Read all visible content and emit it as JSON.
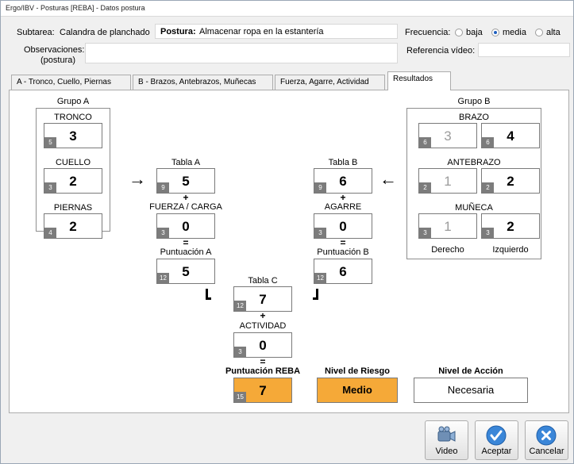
{
  "window": {
    "title": "Ergo/IBV - Posturas [REBA] - Datos postura"
  },
  "header": {
    "subtarea_label": "Subtarea:",
    "subtarea_value": "Calandra de planchado",
    "postura_label": "Postura:",
    "postura_value": "Almacenar ropa en la estantería",
    "frecuencia_label": "Frecuencia:",
    "frecuencia_options": [
      "baja",
      "media",
      "alta"
    ],
    "frecuencia_selected": "media",
    "observaciones_label_1": "Observaciones:",
    "observaciones_label_2": "(postura)",
    "observaciones_value": "",
    "referencia_label": "Referencia vídeo:",
    "referencia_value": ""
  },
  "tabs": [
    {
      "label": "A - Tronco, Cuello, Piernas"
    },
    {
      "label": "B - Brazos, Antebrazos, Muñecas"
    },
    {
      "label": "Fuerza, Agarre, Actividad"
    },
    {
      "label": "Resultados"
    }
  ],
  "active_tab": "Resultados",
  "grupo_a": {
    "title": "Grupo A",
    "tronco": {
      "label": "TRONCO",
      "value": "3",
      "badge": "5"
    },
    "cuello": {
      "label": "CUELLO",
      "value": "2",
      "badge": "3"
    },
    "piernas": {
      "label": "PIERNAS",
      "value": "2",
      "badge": "4"
    }
  },
  "grupo_b": {
    "title": "Grupo B",
    "brazo": {
      "label": "BRAZO",
      "derecho": "3",
      "derecho_badge": "6",
      "izquierdo": "4",
      "izquierdo_badge": "6"
    },
    "antebrazo": {
      "label": "ANTEBRAZO",
      "derecho": "1",
      "derecho_badge": "2",
      "izquierdo": "2",
      "izquierdo_badge": "2"
    },
    "muneca": {
      "label": "MUÑECA",
      "derecho": "1",
      "derecho_badge": "3",
      "izquierdo": "2",
      "izquierdo_badge": "3"
    },
    "derecho_label": "Derecho",
    "izquierdo_label": "Izquierdo"
  },
  "col_a": {
    "tabla_label": "Tabla A",
    "tabla_value": "5",
    "tabla_badge": "9",
    "plus": "+",
    "fuerza_label": "FUERZA / CARGA",
    "fuerza_value": "0",
    "fuerza_badge": "3",
    "equals": "=",
    "puntuacion_label": "Puntuación A",
    "puntuacion_value": "5",
    "puntuacion_badge": "12"
  },
  "col_b": {
    "tabla_label": "Tabla B",
    "tabla_value": "6",
    "tabla_badge": "9",
    "plus": "+",
    "agarre_label": "AGARRE",
    "agarre_value": "0",
    "agarre_badge": "3",
    "equals": "=",
    "puntuacion_label": "Puntuación B",
    "puntuacion_value": "6",
    "puntuacion_badge": "12"
  },
  "col_c": {
    "tabla_label": "Tabla C",
    "tabla_value": "7",
    "tabla_badge": "12",
    "plus": "+",
    "actividad_label": "ACTIVIDAD",
    "actividad_value": "0",
    "actividad_badge": "3",
    "equals": "=",
    "reba_label": "Puntuación REBA",
    "reba_value": "7",
    "reba_badge": "15"
  },
  "riesgo": {
    "label": "Nivel de Riesgo",
    "value": "Medio"
  },
  "accion": {
    "label": "Nivel de Acción",
    "value": "Necesaria"
  },
  "arrows": {
    "left": "→",
    "right": "←"
  },
  "buttons": {
    "video": "Video",
    "aceptar": "Aceptar",
    "cancelar": "Cancelar"
  },
  "colors": {
    "accent_orange": "#f5a938",
    "badge_gray": "#7c7c7c",
    "button_blue": "#3a86d8"
  }
}
